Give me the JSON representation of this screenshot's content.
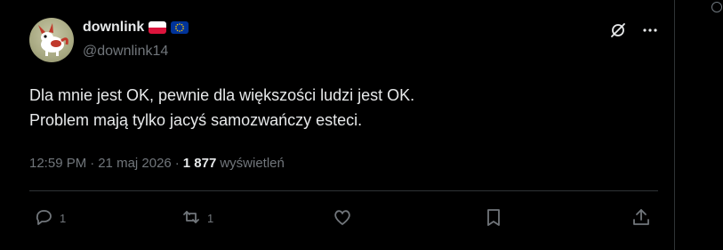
{
  "post": {
    "author_name": "downlink",
    "handle": "@downlink14",
    "text_lines": [
      "Dla mnie jest OK, pewnie dla większości ludzi jest OK.",
      "Problem mają tylko jacyś samozwańczy esteci."
    ],
    "time": "12:59 PM",
    "date": "21 maj 2026",
    "views_count": "1 877",
    "views_label": "wyświetleń"
  },
  "actions": {
    "reply_count": "1",
    "repost_count": "1"
  },
  "icons": {
    "grok": "grok-icon",
    "more": "more-icon",
    "reply": "reply-icon",
    "repost": "repost-icon",
    "like": "heart-icon",
    "bookmark": "bookmark-icon",
    "share": "share-icon"
  },
  "colors": {
    "background": "#000000",
    "text": "#e7e9ea",
    "secondary": "#71767b",
    "border": "#2f3336"
  }
}
